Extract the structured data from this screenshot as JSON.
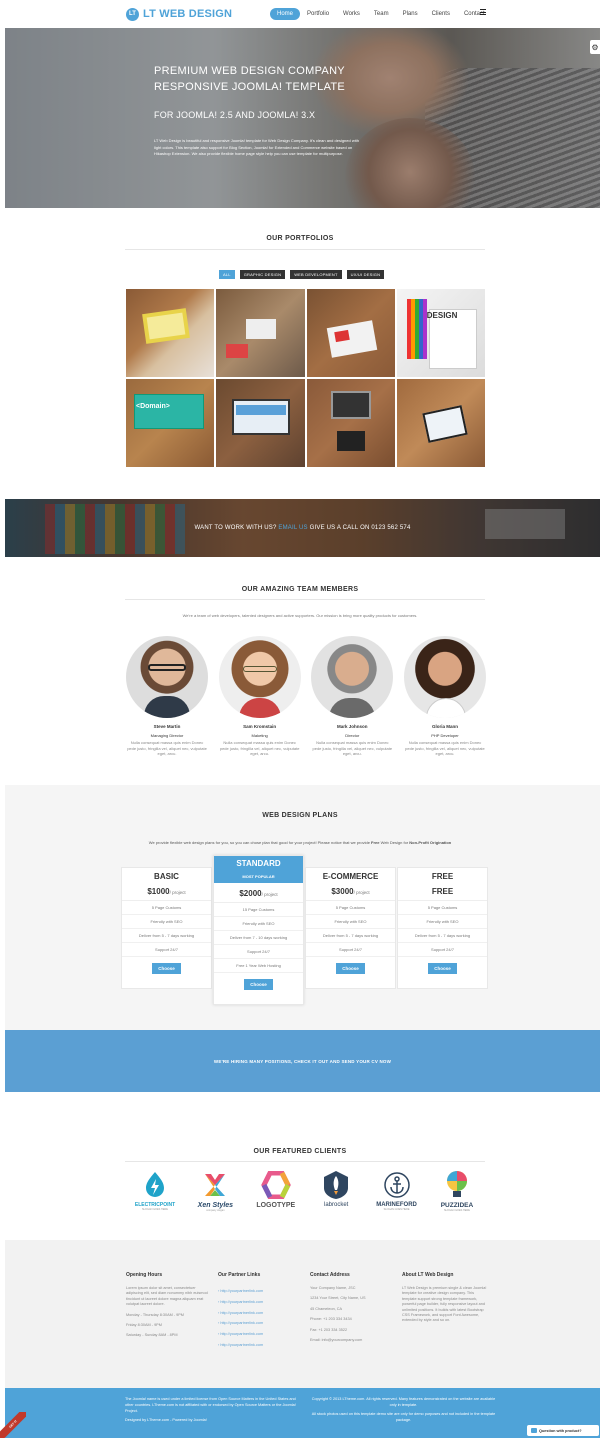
{
  "header": {
    "logo_mark": "LT",
    "logo_text": "LT WEB DESIGN",
    "nav": [
      "Home",
      "Portfolio",
      "Works",
      "Team",
      "Plans",
      "Clients",
      "Contact"
    ]
  },
  "hero": {
    "title_line1": "PREMIUM WEB DESIGN COMPANY",
    "title_line2": "RESPONSIVE JOOMLA! TEMPLATE",
    "subtitle": "FOR JOOMLA! 2.5 AND JOOMLA! 3.X",
    "body": "LT Web Design is beautiful and responsive Joomla! template for Web Design Company. It's clean and designed with light colors. This template also support for Blog Section, Joomla! for Extended and Commerce website based on Hikashop Extension. We also provide flexible home page style help you can use template for multipurpose."
  },
  "portfolio": {
    "title": "OUR PORTFOLIOS",
    "filters": [
      "ALL",
      "GRAPHIC DESIGN",
      "WEB DEVELOPMENT",
      "UX/UI DESIGN"
    ],
    "tile_labels": [
      "",
      "",
      "",
      "DESIGN",
      "<Domain>",
      "",
      "",
      ""
    ]
  },
  "banner": {
    "text_before": "WANT TO WORK WITH US?",
    "link": "EMAIL US",
    "text_after": "GIVE US A CALL ON 0123 562 574"
  },
  "team": {
    "title": "OUR AMAZING TEAM MEMBERS",
    "subtitle": "We're a team of web developers, talented designers and active supporters. Our mission is bring more quality products for customers.",
    "members": [
      {
        "name": "Steve Martin",
        "role": "Managing Director",
        "desc": "Nulla consequat massa quis enim Donec pede justo, fringilla vel, aliquet nec, vulputate eget, arcu."
      },
      {
        "name": "Sam Kromstain",
        "role": "Maketing",
        "desc": "Nulla consequat massa quis enim Donec pede justo, fringilla vel, aliquet nec, vulputate eget, arcu."
      },
      {
        "name": "Mark Johnson",
        "role": "Director",
        "desc": "Nulla consequat massa quis enim Donec pede justo, fringilla vel, aliquet nec, vulputate eget, arcu."
      },
      {
        "name": "Gloria Mann",
        "role": "PHP Developer",
        "desc": "Nulla consequat massa quis enim Donec pede justo, fringilla vel, aliquet nec, vulputate eget, arcu."
      }
    ]
  },
  "plans": {
    "title": "WEB DESIGN PLANS",
    "intro_before": "We provide flexible web design plans for you, so you can chose plan that good for your project! Please notice that we provide",
    "intro_free": "Free",
    "intro_mid": "Web Design for",
    "intro_np": "Non-Profit Origination",
    "items": [
      {
        "name": "BASIC",
        "price": "$1000",
        "unit": "/ project",
        "features": [
          "5 Page Customs",
          "Friendly with SEO",
          "Deliver from 5 - 7 days working",
          "Support 24/7"
        ],
        "button": "Choose"
      },
      {
        "name": "STANDARD",
        "badge": "MOST POPULAR",
        "price": "$2000",
        "unit": "/ project",
        "features": [
          "15 Page Customs",
          "Friendly with SEO",
          "Deliver from 7 - 10 days working",
          "Support 24/7",
          "Free 1 Year Web Hosting"
        ],
        "button": "Choose"
      },
      {
        "name": "E-COMMERCE",
        "price": "$3000",
        "unit": "/ project",
        "features": [
          "5 Page Customs",
          "Friendly with SEO",
          "Deliver from 5 - 7 days working",
          "Support 24/7"
        ],
        "button": "Choose"
      },
      {
        "name": "FREE",
        "price": "FREE",
        "unit": "",
        "features": [
          "5 Page Customs",
          "Friendly with SEO",
          "Deliver from 5 - 7 days working",
          "Support 24/7"
        ],
        "button": "Choose"
      }
    ]
  },
  "hiring": {
    "text": "WE'RE HIRING MANY POSITIONS, CHECK IT OUT AND SEND YOUR CV NOW"
  },
  "clients": {
    "title": "OUR FEATURED CLIENTS",
    "items": [
      {
        "name": "ELECTRICPOINT",
        "slogan": "SLOGAN GOES HERE",
        "color": "#1fa3c9"
      },
      {
        "name": "Xen Styles",
        "slogan": "company slogan",
        "color": "#2b4a6a"
      },
      {
        "name": "LOGOTYPE",
        "slogan": "",
        "color": "#555555"
      },
      {
        "name": "labrocket",
        "slogan": "",
        "color": "#2f4660"
      },
      {
        "name": "MARINEFORD",
        "slogan": "SLOGAN GOES HERE",
        "color": "#2f4660"
      },
      {
        "name": "PUZZIDEA",
        "slogan": "SLOGAN GOES HERE",
        "color": "#2f4660"
      }
    ]
  },
  "footer": {
    "opening": {
      "title": "Opening Hours",
      "text": "Lorem ipsum dolor sit amet, consectetuer adipiscing elit, sed diam nonummy nibh euismod tincidunt ut laoreet dolore magna aliquam erat volutpat laoreet dolore.",
      "hours": [
        "Monday - Thursday 8:30AM - 9PM",
        "Friday 8:30AM - 9PM",
        "Saturday - Sunday 8AM - 8PM"
      ]
    },
    "partners": {
      "title": "Our Partner Links",
      "links": [
        "http://yourpartnerlink.com",
        "http://yourpartnerlink.com",
        "http://yourpartnerlink.com",
        "http://yourpartnerlink.com",
        "http://yourpartnerlink.com",
        "http://yourpartnerlink.com"
      ]
    },
    "contact": {
      "title": "Contact Address",
      "lines": [
        "Your Company Name, JSC",
        "1234 Your Street, City Name, US",
        "45 Chameleon, CA",
        "Phone: +1 203 334 3434",
        "Fax: +1 203 334 3522",
        "Email: info@yourcompany.com"
      ]
    },
    "about": {
      "title": "About LT Web Design",
      "text": "LT Web Design is premium single & clean Joomla! template for creative design company. This template support strong template framework, powerful page builder, fully responsive layout and unlimited positions. It builds with latest Bootstrap CSS Framework, and support Font Awesome, extended by style and so on."
    }
  },
  "bottom": {
    "left": "The Joomla! name is used under a limited license from Open Source Matters in the United States and other countries. LTheme.com is not affiliated with or endorsed by Open Source Matters or the Joomla! Project.",
    "left2": "Designed by LTheme.com - Powered by Joomla!",
    "right": "Copyright © 2013 LTheme.com. All rights reserved. Many features demonstrated on the website are available only in template.",
    "right2": "All stock photos used on this template demo site are only for demo purposes and not included in the template package."
  },
  "chat": {
    "label": "Question with product?"
  },
  "ribbon": {
    "label": "GET IT"
  }
}
